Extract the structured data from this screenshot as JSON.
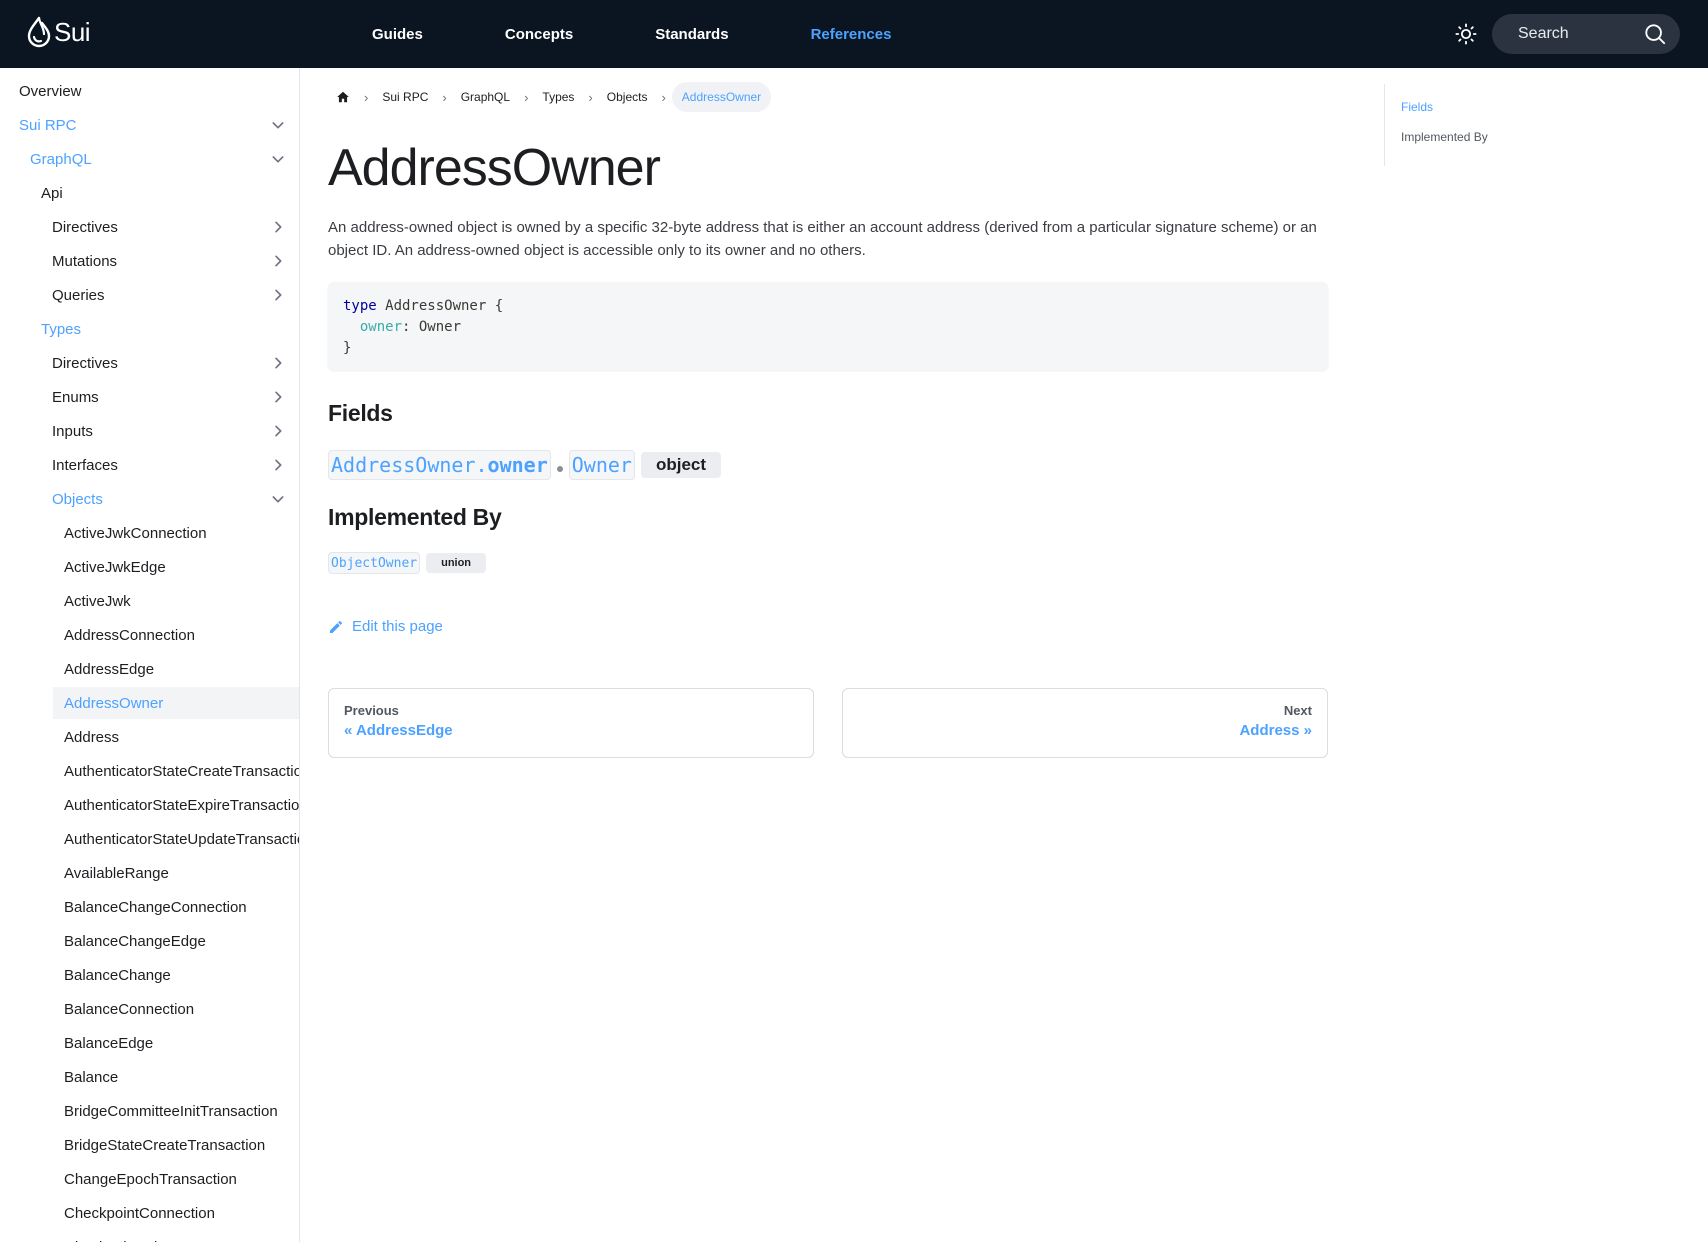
{
  "header": {
    "logo_text": "Sui",
    "nav": [
      {
        "label": "Guides",
        "active": false
      },
      {
        "label": "Concepts",
        "active": false
      },
      {
        "label": "Standards",
        "active": false
      },
      {
        "label": "References",
        "active": true
      }
    ],
    "theme_icon": "sun-icon",
    "search_label": "Search"
  },
  "sidebar": {
    "items": [
      {
        "label": "Overview"
      },
      {
        "label": "Sui RPC",
        "caret": "chevron-down"
      },
      {
        "label": "GraphQL",
        "caret": "chevron-down"
      },
      {
        "label": "Api"
      },
      {
        "label": "Directives",
        "caret": "chevron-right"
      },
      {
        "label": "Mutations",
        "caret": "chevron-right"
      },
      {
        "label": "Queries",
        "caret": "chevron-right"
      },
      {
        "label": "Types"
      },
      {
        "label": "Directives",
        "caret": "chevron-right"
      },
      {
        "label": "Enums",
        "caret": "chevron-right"
      },
      {
        "label": "Inputs",
        "caret": "chevron-right"
      },
      {
        "label": "Interfaces",
        "caret": "chevron-right"
      },
      {
        "label": "Objects",
        "caret": "chevron-down"
      },
      {
        "label": "ActiveJwkConnection"
      },
      {
        "label": "ActiveJwkEdge"
      },
      {
        "label": "ActiveJwk"
      },
      {
        "label": "AddressConnection"
      },
      {
        "label": "AddressEdge"
      },
      {
        "label": "AddressOwner",
        "selected": true
      },
      {
        "label": "Address"
      },
      {
        "label": "AuthenticatorStateCreateTransaction"
      },
      {
        "label": "AuthenticatorStateExpireTransaction"
      },
      {
        "label": "AuthenticatorStateUpdateTransaction"
      },
      {
        "label": "AvailableRange"
      },
      {
        "label": "BalanceChangeConnection"
      },
      {
        "label": "BalanceChangeEdge"
      },
      {
        "label": "BalanceChange"
      },
      {
        "label": "BalanceConnection"
      },
      {
        "label": "BalanceEdge"
      },
      {
        "label": "Balance"
      },
      {
        "label": "BridgeCommitteeInitTransaction"
      },
      {
        "label": "BridgeStateCreateTransaction"
      },
      {
        "label": "ChangeEpochTransaction"
      },
      {
        "label": "CheckpointConnection"
      },
      {
        "label": "CheckpointEdge"
      }
    ]
  },
  "breadcrumbs": {
    "home_icon": "home-icon",
    "items": [
      "Sui RPC",
      "GraphQL",
      "Types",
      "Objects"
    ],
    "current": "AddressOwner"
  },
  "page": {
    "title": "AddressOwner",
    "description": "An address-owned object is owned by a specific 32-byte address that is either an account address (derived from a particular signature scheme) or an object ID. An address-owned object is accessible only to its owner and no others.",
    "code": {
      "kw": "type",
      "line1_rest": " AddressOwner {",
      "field": "owner",
      "field_rest": ": Owner",
      "close": "}"
    },
    "fields_heading": "Fields",
    "field": {
      "type_name": "AddressOwner.",
      "field_name": "owner",
      "return_type": "Owner",
      "kind": "object"
    },
    "implemented_heading": "Implemented By",
    "implemented": {
      "name": "ObjectOwner",
      "kind": "union"
    },
    "edit_label": "Edit this page",
    "edit_icon": "pencil-icon",
    "prev": {
      "sub": "Previous",
      "label": "« AddressEdge"
    },
    "next": {
      "sub": "Next",
      "label": "Address »"
    }
  },
  "toc": {
    "items": [
      {
        "label": "Fields",
        "active": true
      },
      {
        "label": "Implemented By",
        "active": false
      }
    ]
  },
  "colors": {
    "accent": "#4da2ff",
    "navbar_bg": "#0b1522"
  }
}
